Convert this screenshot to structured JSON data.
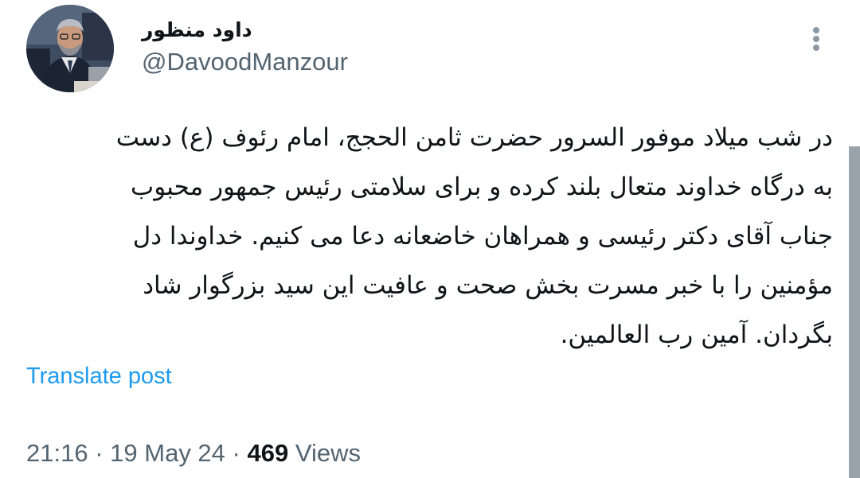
{
  "author": {
    "display_name": "داود منظور",
    "handle": "@DavoodManzour",
    "avatar_icon": "profile-photo"
  },
  "more_icon": "more-vertical-icon",
  "tweet": {
    "lines": [
      "در شب میلاد موفور السرور حضرت ثامن الحجج، امام رئوف (ع) دست",
      "به درگاه خداوند متعال بلند کرده و  برای سلامتی رئیس جمهور محبوب",
      "جناب آقای دکتر رئیسی و همراهان خاضعانه دعا می کنیم. خداوندا دل",
      "مؤمنین را با خبر مسرت بخش صحت و عافیت این سید بزرگوار شاد",
      "بگردان. آمین رب العالمین."
    ]
  },
  "translate_label": "Translate post",
  "meta": {
    "time": "21:16",
    "separator": "·",
    "date": "19 May 24",
    "views_count": "469",
    "views_label": "Views"
  },
  "colors": {
    "text": "#0f1419",
    "secondary": "#536471",
    "link": "#1d9bf0",
    "scrollbar": "#9aa3ab"
  }
}
